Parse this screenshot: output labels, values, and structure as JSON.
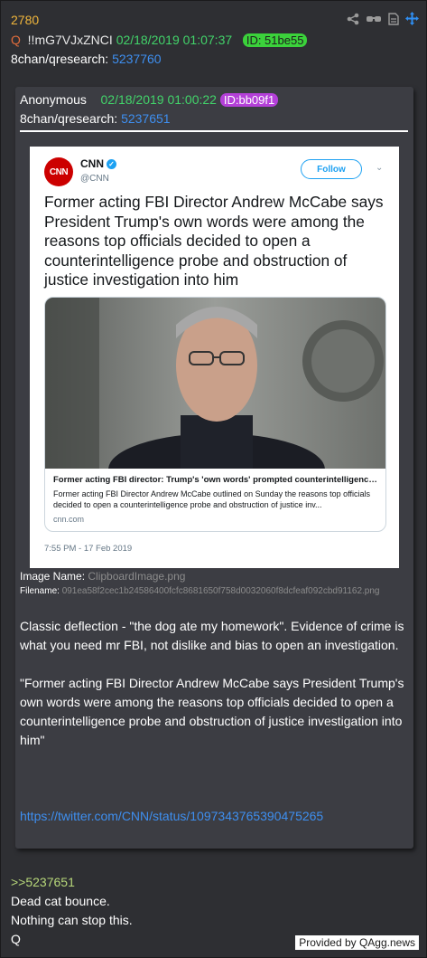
{
  "post": {
    "number": "2780",
    "q_label": "Q",
    "tripcode": "!!mG7VJxZNCI",
    "datetime": "02/18/2019 01:07:37",
    "id_badge": "ID: 51be55",
    "board": "8chan/qresearch:",
    "post_link": "5237760"
  },
  "header_icons": [
    "share-icon",
    "glasses-icon",
    "document-icon",
    "move-icon"
  ],
  "quoted": {
    "author": "Anonymous",
    "datetime": "02/18/2019 01:00:22",
    "id_badge": "ID:bb09f1",
    "board": "8chan/qresearch:",
    "post_link": "5237651",
    "tweet": {
      "logo_text": "CNN",
      "name": "CNN",
      "handle": "@CNN",
      "follow_label": "Follow",
      "text": "Former acting FBI Director Andrew McCabe says President Trump's own words were among the reasons top officials decided to open a counterintelligence probe and obstruction of justice investigation into him",
      "card_title": "Former acting FBI director: Trump's 'own words' prompted counterintelligence probe",
      "card_desc": "Former acting FBI Director Andrew McCabe outlined on Sunday the reasons top officials decided to open a counterintelligence probe and obstruction of justice inv...",
      "card_domain": "cnn.com",
      "time": "7:55 PM - 17 Feb 2019"
    },
    "image_name_label": "Image Name:",
    "image_name": "ClipboardImage.png",
    "filename_label": "Filename:",
    "filename": "091ea58f2cec1b24586400fcfc8681650f758d0032060f8dcfeaf092cbd91162.png",
    "paragraph1": "Classic deflection - \"the dog ate my homework\". Evidence of crime is what you need mr FBI, not dislike and bias to open an investigation.",
    "paragraph2": "\"Former acting FBI Director Andrew McCabe says President Trump's own words were among the reasons top officials decided to open a counterintelligence probe and obstruction of justice investigation into him\"",
    "url": "https://twitter.com/CNN/status/1097343765390475265"
  },
  "reply": {
    "ref": ">>5237651",
    "line1": "Dead cat bounce.",
    "line2": "Nothing can stop this.",
    "sign": "Q"
  },
  "footer": {
    "provided_by": "Provided by QAgg.news"
  },
  "colors": {
    "background": "#2e2f33",
    "quote_bg": "#3c3d43",
    "post_number": "#f0b63c",
    "date": "#42d46a",
    "link": "#3e8ff0",
    "id_badge_green": "#3bd23b",
    "id_badge_purple": "#b440d8",
    "greentext": "#b7d77a"
  }
}
